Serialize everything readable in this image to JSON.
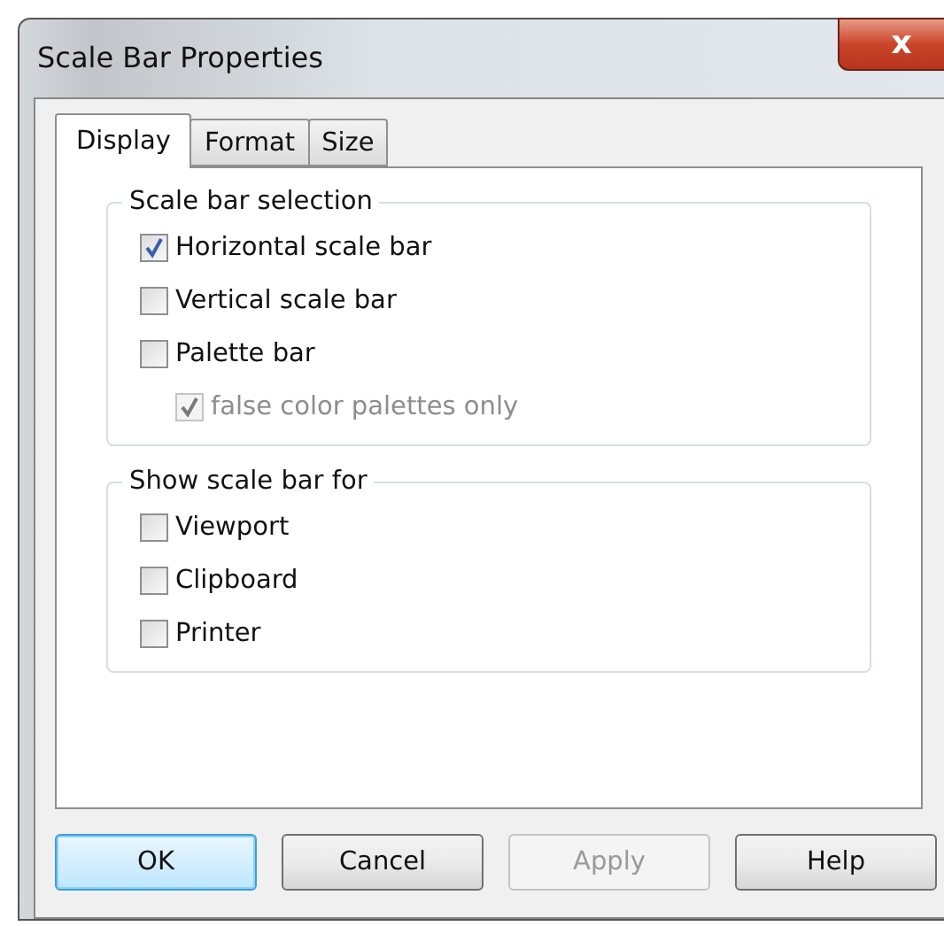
{
  "window": {
    "title": "Scale Bar Properties",
    "close_label": "x"
  },
  "tabs": [
    {
      "label": "Display",
      "selected": true
    },
    {
      "label": "Format",
      "selected": false
    },
    {
      "label": "Size",
      "selected": false
    }
  ],
  "groups": [
    {
      "title": "Scale bar selection",
      "options": [
        {
          "label": "Horizontal scale bar",
          "checked": true,
          "disabled": false
        },
        {
          "label": "Vertical scale bar",
          "checked": false,
          "disabled": false
        },
        {
          "label": "Palette bar",
          "checked": false,
          "disabled": false,
          "children": [
            {
              "label": "false color palettes only",
              "checked": true,
              "disabled": true
            }
          ]
        }
      ]
    },
    {
      "title": "Show scale bar for",
      "options": [
        {
          "label": "Viewport",
          "checked": false,
          "disabled": false
        },
        {
          "label": "Clipboard",
          "checked": false,
          "disabled": false
        },
        {
          "label": "Printer",
          "checked": false,
          "disabled": false
        }
      ]
    }
  ],
  "buttons": [
    {
      "label": "OK",
      "default": true,
      "disabled": false
    },
    {
      "label": "Cancel",
      "default": false,
      "disabled": false
    },
    {
      "label": "Apply",
      "default": false,
      "disabled": true
    },
    {
      "label": "Help",
      "default": false,
      "disabled": false
    }
  ]
}
